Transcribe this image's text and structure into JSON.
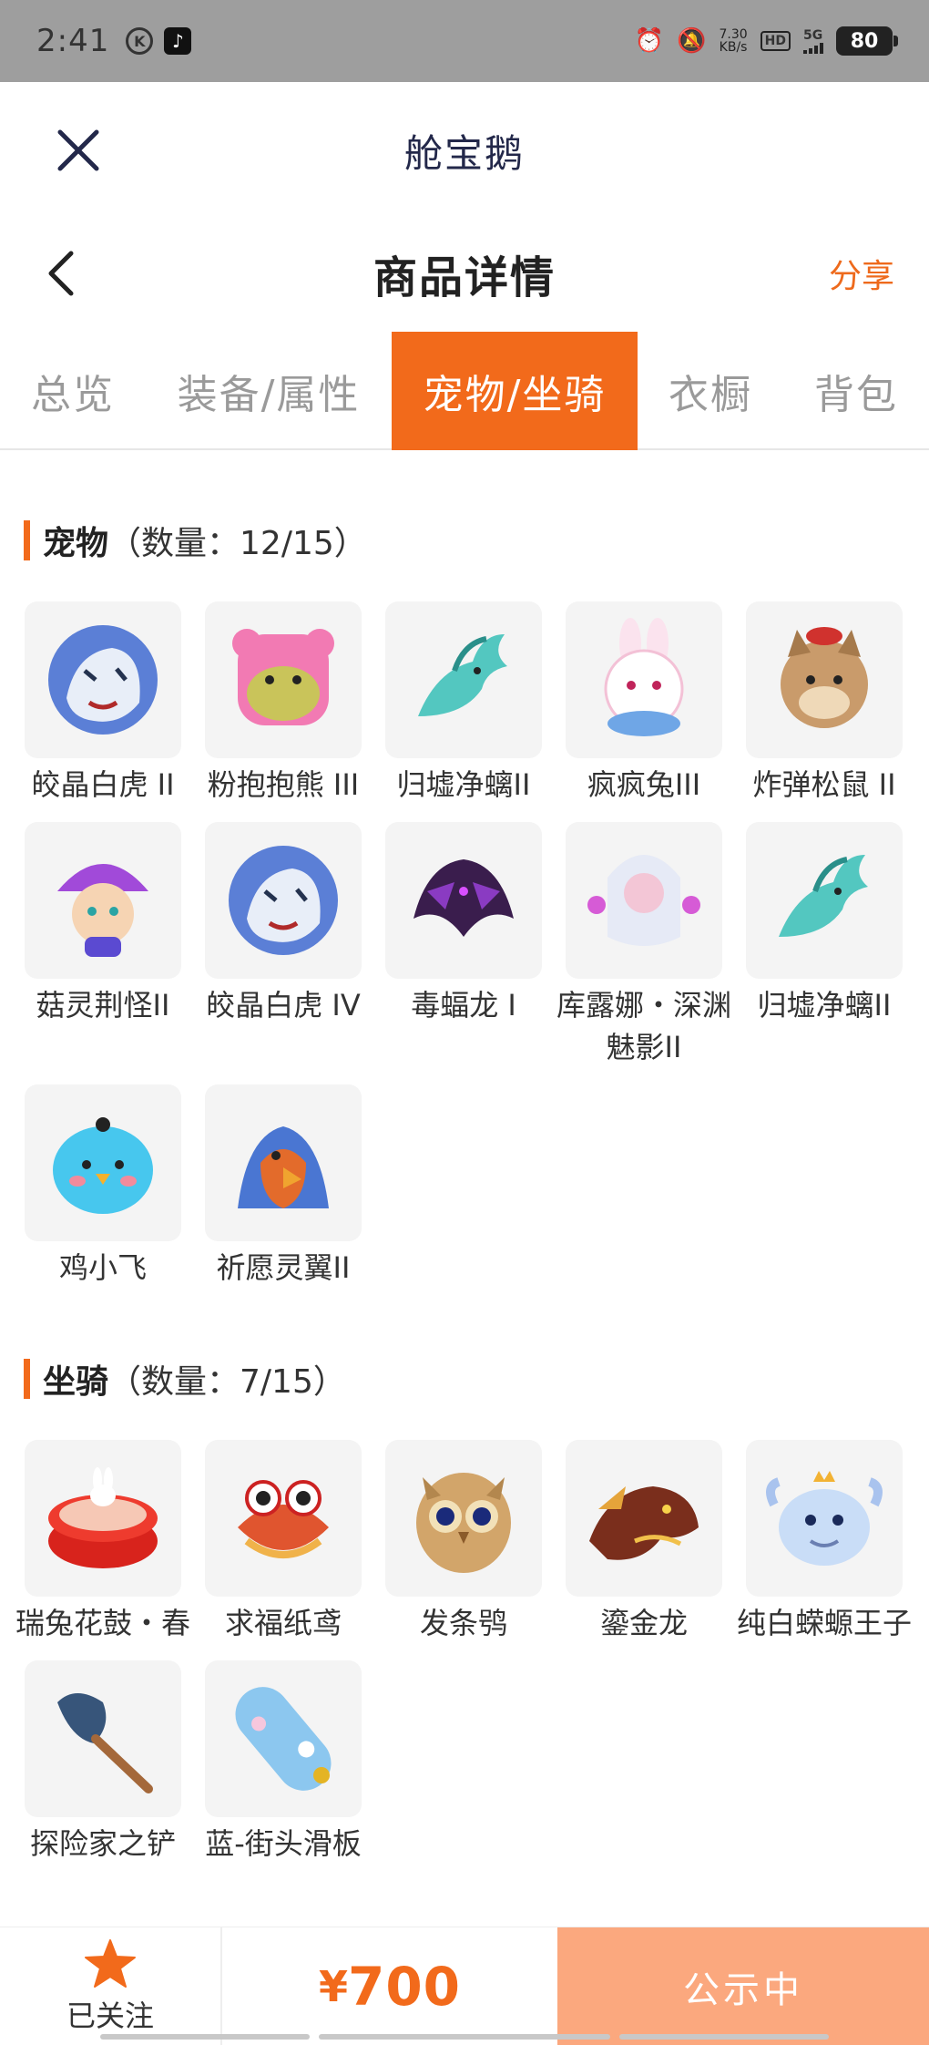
{
  "status_bar": {
    "time": "2:41",
    "net_speed_value": "7.30",
    "net_speed_unit": "KB/s",
    "hd": "HD",
    "network": "5G",
    "battery": "80"
  },
  "app": {
    "title": "舱宝鹅"
  },
  "page": {
    "title": "商品详情",
    "share": "分享"
  },
  "tabs": [
    {
      "label": "总览"
    },
    {
      "label": "装备/属性"
    },
    {
      "label": "宠物/坐骑",
      "active": true
    },
    {
      "label": "衣橱"
    },
    {
      "label": "背包"
    }
  ],
  "pets_section": {
    "title": "宠物",
    "count": "（数量：12/15）",
    "items": [
      {
        "name": "皎晶白虎 II",
        "icon": "white-tiger-icon"
      },
      {
        "name": "粉抱抱熊 III",
        "icon": "pink-bear-icon"
      },
      {
        "name": "归墟净螭II",
        "icon": "teal-dragon-icon"
      },
      {
        "name": "疯疯兔III",
        "icon": "crazy-rabbit-icon"
      },
      {
        "name": "炸弹松鼠 II",
        "icon": "bomb-squirrel-icon"
      },
      {
        "name": "菇灵荆怪II",
        "icon": "mushroom-sprite-icon"
      },
      {
        "name": "皎晶白虎 IV",
        "icon": "white-tiger-icon"
      },
      {
        "name": "毒蝠龙 I",
        "icon": "bat-dragon-icon"
      },
      {
        "name": "库露娜・深渊魅影II",
        "icon": "abyss-phantom-icon"
      },
      {
        "name": "归墟净螭II",
        "icon": "teal-dragon-icon"
      },
      {
        "name": "鸡小飞",
        "icon": "blue-chick-icon"
      },
      {
        "name": "祈愿灵翼II",
        "icon": "wish-griffin-icon"
      }
    ]
  },
  "mounts_section": {
    "title": "坐骑",
    "count": "（数量：7/15）",
    "items": [
      {
        "name": "瑞兔花鼓・春",
        "icon": "rabbit-drum-icon"
      },
      {
        "name": "求福纸鸢",
        "icon": "goldfish-kite-icon"
      },
      {
        "name": "发条鸮",
        "icon": "clockwork-owl-icon"
      },
      {
        "name": "鎏金龙",
        "icon": "gilded-dragon-icon"
      },
      {
        "name": "纯白蝾螈王子",
        "icon": "white-axolotl-icon"
      },
      {
        "name": "探险家之铲",
        "icon": "explorer-shovel-icon"
      },
      {
        "name": "蓝-街头滑板",
        "icon": "blue-skateboard-icon"
      }
    ]
  },
  "bottom_bar": {
    "follow_label": "已关注",
    "price_symbol": "¥",
    "price": "700",
    "status": "公示中"
  },
  "colors": {
    "accent": "#f26a1b",
    "accent_light": "#fba87e",
    "title": "#23284a"
  }
}
